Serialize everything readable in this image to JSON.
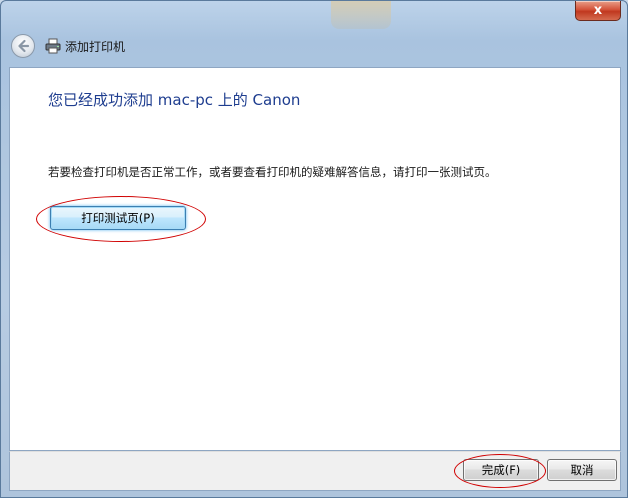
{
  "titlebar": {
    "close_symbol": "x",
    "close_color": "#c8402a"
  },
  "nav": {
    "back_icon": "back-arrow-icon",
    "app_icon": "printer-icon",
    "title": "添加打印机"
  },
  "content": {
    "heading": "您已经成功添加 mac-pc 上的 Canon",
    "description": "若要检查打印机是否正常工作，或者要查看打印机的疑难解答信息，请打印一张测试页。",
    "print_test_label": "打印测试页(P)"
  },
  "footer": {
    "finish_label": "完成(F)",
    "cancel_label": "取消"
  },
  "colors": {
    "heading": "#1e3d8f",
    "annotation": "#d00000"
  }
}
